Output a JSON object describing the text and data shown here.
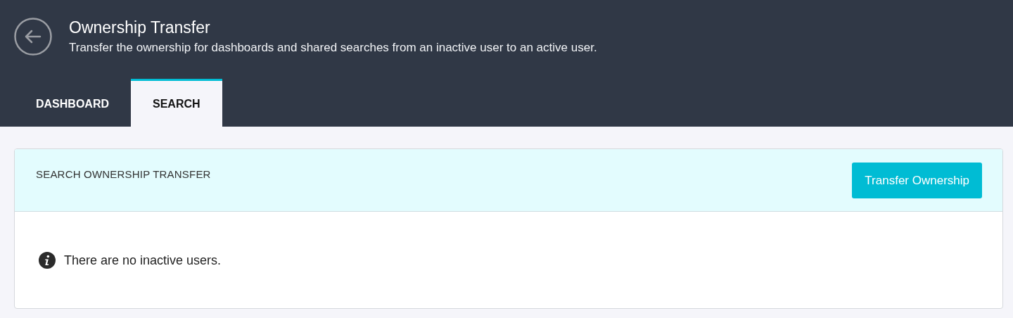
{
  "header": {
    "title": "Ownership Transfer",
    "subtitle": "Transfer the ownership for dashboards and shared searches from an inactive user to an active user."
  },
  "tabs": [
    {
      "label": "DASHBOARD",
      "selected": false
    },
    {
      "label": "SEARCH",
      "selected": true
    }
  ],
  "panel": {
    "title": "SEARCH OWNERSHIP TRANSFER",
    "button": "Transfer Ownership",
    "message": "There are no inactive users."
  }
}
